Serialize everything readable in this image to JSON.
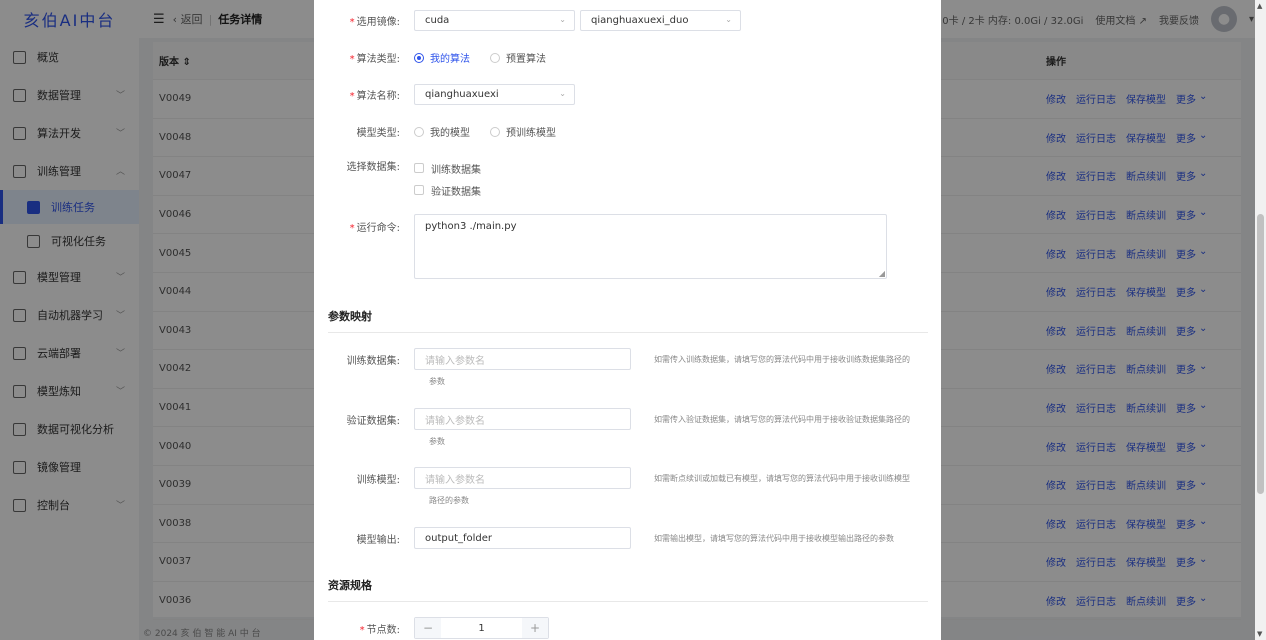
{
  "app": {
    "logo": "亥伯AI中台"
  },
  "sidebar": {
    "items": [
      {
        "label": "概览",
        "icon": "dashboard-icon",
        "expandable": false
      },
      {
        "label": "数据管理",
        "icon": "database-icon",
        "expandable": true
      },
      {
        "label": "算法开发",
        "icon": "code-icon",
        "expandable": true
      },
      {
        "label": "训练管理",
        "icon": "train-icon",
        "expandable": true,
        "expanded": true
      },
      {
        "label": "训练任务",
        "icon": "layers-icon",
        "sub": true,
        "active": true
      },
      {
        "label": "可视化任务",
        "icon": "chart-icon",
        "sub": true
      },
      {
        "label": "模型管理",
        "icon": "model-icon",
        "expandable": true
      },
      {
        "label": "自动机器学习",
        "icon": "automl-icon",
        "expandable": true
      },
      {
        "label": "云端部署",
        "icon": "cloud-icon",
        "expandable": true
      },
      {
        "label": "模型炼知",
        "icon": "knowledge-icon",
        "expandable": true
      },
      {
        "label": "数据可视化分析",
        "icon": "analytics-icon",
        "expandable": false
      },
      {
        "label": "镜像管理",
        "icon": "image-icon",
        "expandable": false
      },
      {
        "label": "控制台",
        "icon": "console-icon",
        "expandable": true
      }
    ]
  },
  "topbar": {
    "back": "返回",
    "title": "任务详情",
    "resources": "PU: 0卡 / 2卡 内存: 0.0Gi / 32.0Gi",
    "docs": "使用文档",
    "feedback": "我要反馈"
  },
  "table": {
    "col_version": "版本",
    "col_ops": "操作",
    "rows": [
      {
        "version": "V0049",
        "ops": [
          "修改",
          "运行日志",
          "保存模型",
          "更多"
        ]
      },
      {
        "version": "V0048",
        "ops": [
          "修改",
          "运行日志",
          "保存模型",
          "更多"
        ]
      },
      {
        "version": "V0047",
        "ops": [
          "修改",
          "运行日志",
          "断点续训",
          "更多"
        ]
      },
      {
        "version": "V0046",
        "ops": [
          "修改",
          "运行日志",
          "断点续训",
          "更多"
        ]
      },
      {
        "version": "V0045",
        "ops": [
          "修改",
          "运行日志",
          "断点续训",
          "更多"
        ]
      },
      {
        "version": "V0044",
        "ops": [
          "修改",
          "运行日志",
          "保存模型",
          "更多"
        ]
      },
      {
        "version": "V0043",
        "ops": [
          "修改",
          "运行日志",
          "断点续训",
          "更多"
        ]
      },
      {
        "version": "V0042",
        "ops": [
          "修改",
          "运行日志",
          "断点续训",
          "更多"
        ]
      },
      {
        "version": "V0041",
        "ops": [
          "修改",
          "运行日志",
          "断点续训",
          "更多"
        ]
      },
      {
        "version": "V0040",
        "ops": [
          "修改",
          "运行日志",
          "保存模型",
          "更多"
        ]
      },
      {
        "version": "V0039",
        "ops": [
          "修改",
          "运行日志",
          "断点续训",
          "更多"
        ]
      },
      {
        "version": "V0038",
        "ops": [
          "修改",
          "运行日志",
          "保存模型",
          "更多"
        ]
      },
      {
        "version": "V0037",
        "ops": [
          "修改",
          "运行日志",
          "保存模型",
          "更多"
        ]
      },
      {
        "version": "V0036",
        "ops": [
          "修改",
          "运行日志",
          "断点续训",
          "更多"
        ]
      }
    ]
  },
  "footer": "© 2024 亥 伯 智 能 AI 中 台",
  "form": {
    "image_label": "选用镜像:",
    "image_value": "cuda",
    "image_tag_value": "qianghuaxuexi_duo",
    "algo_type_label": "算法类型:",
    "algo_type_opt1": "我的算法",
    "algo_type_opt2": "预置算法",
    "algo_name_label": "算法名称:",
    "algo_name_value": "qianghuaxuexi",
    "model_type_label": "模型类型:",
    "model_type_opt1": "我的模型",
    "model_type_opt2": "预训练模型",
    "dataset_label": "选择数据集:",
    "dataset_opt1": "训练数据集",
    "dataset_opt2": "验证数据集",
    "cmd_label": "运行命令:",
    "cmd_value": "python3 ./main.py",
    "param_section": "参数映射",
    "p_train_label": "训练数据集:",
    "p_train_ph": "请输入参数名",
    "p_train_hint": "如需传入训练数据集，请填写您的算法代码中用于接收训练数据集路径的",
    "p_train_hint2": "参数",
    "p_val_label": "验证数据集:",
    "p_val_ph": "请输入参数名",
    "p_val_hint": "如需传入验证数据集，请填写您的算法代码中用于接收验证数据集路径的",
    "p_val_hint2": "参数",
    "p_model_label": "训练模型:",
    "p_model_ph": "请输入参数名",
    "p_model_hint": "如需断点续训或加载已有模型，请填写您的算法代码中用于接收训练模型",
    "p_model_hint2": "路径的参数",
    "p_out_label": "模型输出:",
    "p_out_value": "output_folder",
    "p_out_hint": "如需输出模型，请填写您的算法代码中用于接收模型输出路径的参数",
    "res_section": "资源规格",
    "nodes_label": "节点数:",
    "nodes_value": "1"
  }
}
